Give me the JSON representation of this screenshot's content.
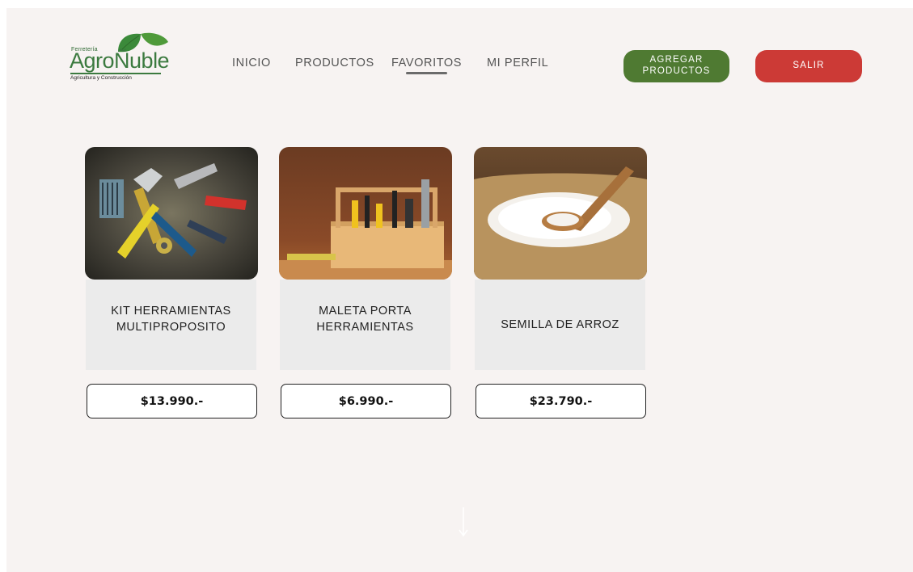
{
  "logo": {
    "top_text": "Ferretería",
    "name": "AgroÑuble",
    "subtitle": "Agricultura y Construcción"
  },
  "nav": {
    "items": [
      {
        "label": "INICIO"
      },
      {
        "label": "PRODUCTOS"
      },
      {
        "label": "FAVORITOS"
      },
      {
        "label": "MI PERFIL"
      }
    ],
    "active": "FAVORITOS"
  },
  "buttons": {
    "add_products": "AGREGAR\nPRODUCTOS",
    "exit": "SALIR"
  },
  "products": [
    {
      "title": "KIT  HERRAMIENTAS\nMULTIPROPOSITO",
      "price": "$13.990.-",
      "image": "tools-kit-photo"
    },
    {
      "title": "MALETA PORTA\nHERRAMIENTAS",
      "price": "$6.990.-",
      "image": "toolbox-photo"
    },
    {
      "title": "SEMILLA DE ARROZ",
      "price": "$23.790.-",
      "image": "rice-sack-photo"
    }
  ],
  "colors": {
    "page_bg": "#f7f3f2",
    "add_button": "#4f7a32",
    "exit_button": "#cc3a36",
    "card_body": "#ebebeb"
  },
  "icons": {
    "scroll": "arrow-down-icon"
  }
}
